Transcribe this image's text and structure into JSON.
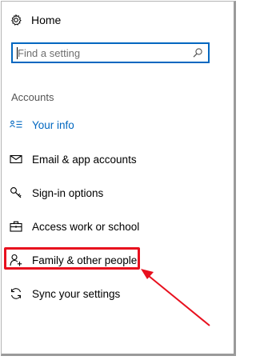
{
  "nav": {
    "home_label": "Home",
    "search_placeholder": "Find a setting",
    "section_heading": "Accounts",
    "items": [
      {
        "label": "Your info",
        "icon": "your-info-icon",
        "active": true
      },
      {
        "label": "Email & app accounts",
        "icon": "email-icon",
        "active": false
      },
      {
        "label": "Sign-in options",
        "icon": "key-icon",
        "active": false
      },
      {
        "label": "Access work or school",
        "icon": "briefcase-icon",
        "active": false
      },
      {
        "label": "Family & other people",
        "icon": "person-add-icon",
        "active": false
      },
      {
        "label": "Sync your settings",
        "icon": "sync-icon",
        "active": false
      }
    ]
  },
  "colors": {
    "accent": "#0067c0",
    "annotation_red": "#e8101e"
  },
  "annotation": {
    "highlighted_item": "Family & other people"
  }
}
